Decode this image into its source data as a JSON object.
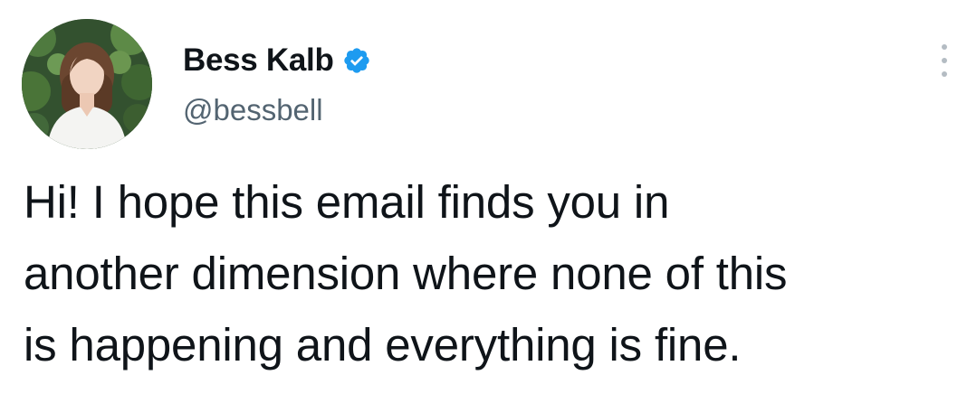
{
  "tweet": {
    "author": {
      "display_name": "Bess Kalb",
      "handle": "@bessbell",
      "verified": true
    },
    "text_lines": [
      "Hi! I hope this email finds you in",
      "another dimension where none of this",
      "is happening and everything is fine."
    ]
  },
  "icons": {
    "verified": "verified-badge-icon",
    "more": "more-options-icon"
  },
  "colors": {
    "verified_blue": "#1d9bf0",
    "text": "#0f1419",
    "secondary_text": "#536471"
  }
}
